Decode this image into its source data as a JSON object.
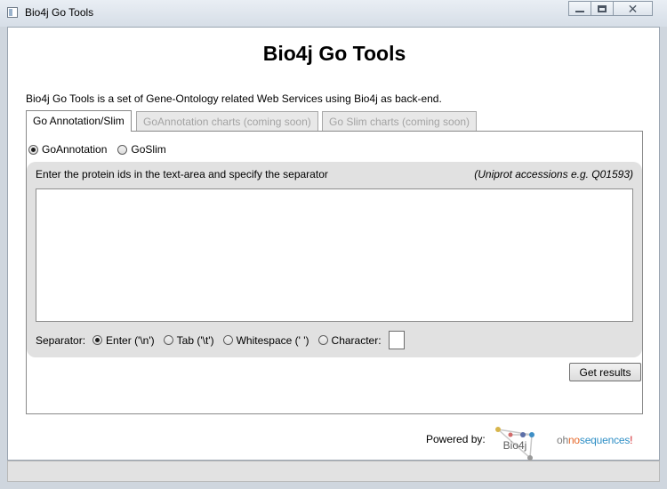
{
  "window": {
    "title": "Bio4j Go Tools",
    "controls": {
      "minimize": "minimize-icon",
      "maximize": "maximize-icon",
      "close": "close-icon"
    }
  },
  "header": {
    "title": "Bio4j Go Tools",
    "description": "Bio4j Go Tools is a set of Gene-Ontology related Web Services using Bio4j as back-end."
  },
  "tabs": [
    {
      "label": "Go Annotation/Slim",
      "active": true
    },
    {
      "label": "GoAnnotation charts (coming soon)",
      "active": false
    },
    {
      "label": "Go Slim charts (coming soon)",
      "active": false
    }
  ],
  "mode": {
    "options": [
      "GoAnnotation",
      "GoSlim"
    ],
    "selected": "GoAnnotation"
  },
  "input": {
    "instructions": "Enter the protein ids in the text-area and specify the separator",
    "hint": "(Uniprot accessions e.g. Q01593)",
    "value": ""
  },
  "separator": {
    "label": "Separator:",
    "options": [
      "Enter ('\\n')",
      "Tab ('\\t')",
      "Whitespace (' ')",
      "Character:"
    ],
    "selected": "Enter ('\\n')",
    "character_value": ""
  },
  "actions": {
    "get_results": "Get results"
  },
  "footer": {
    "powered_by": "Powered by:",
    "bio4j_logo_text": "Bio4j",
    "ohno_parts": [
      "oh",
      "no",
      "sequences",
      "!"
    ]
  },
  "colors": {
    "ohno_oh": "#7a7a7a",
    "ohno_no": "#e66a2c",
    "ohno_sequences": "#2f8fc6",
    "ohno_bang": "#d2232a"
  }
}
